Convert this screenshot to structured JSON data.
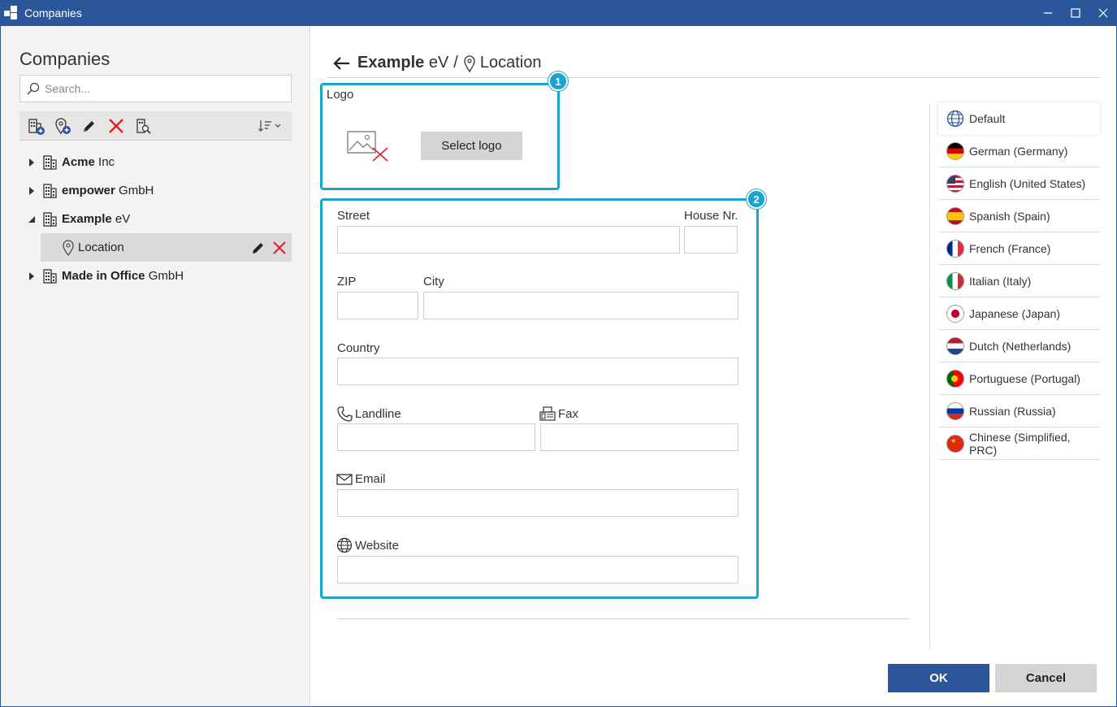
{
  "window": {
    "title": "Companies"
  },
  "sidebar": {
    "heading": "Companies",
    "search_placeholder": "Search...",
    "tree": [
      {
        "bold": "Acme",
        "rest": " Inc"
      },
      {
        "bold": "empower",
        "rest": " GmbH"
      },
      {
        "bold": "Example",
        "rest": " eV",
        "expanded": true
      },
      {
        "bold": "Made in Office",
        "rest": " GmbH"
      }
    ],
    "child": {
      "label": "Location"
    }
  },
  "breadcrumb": {
    "bold": "Example",
    "rest": " eV",
    "separator": "/",
    "current": "Location"
  },
  "callouts": {
    "one": "1",
    "two": "2"
  },
  "logo": {
    "label": "Logo",
    "button": "Select logo"
  },
  "form": {
    "street": "Street",
    "house_nr": "House Nr.",
    "zip": "ZIP",
    "city": "City",
    "country": "Country",
    "landline": "Landline",
    "fax": "Fax",
    "email": "Email",
    "website": "Website"
  },
  "languages": [
    "Default",
    "German (Germany)",
    "English (United States)",
    "Spanish (Spain)",
    "French (France)",
    "Italian (Italy)",
    "Japanese (Japan)",
    "Dutch (Netherlands)",
    "Portuguese (Portugal)",
    "Russian (Russia)",
    "Chinese (Simplified, PRC)"
  ],
  "footer": {
    "ok": "OK",
    "cancel": "Cancel"
  },
  "colors": {
    "accent": "#2b579a",
    "callout": "#1ba4cf",
    "delete": "#e01e26"
  }
}
